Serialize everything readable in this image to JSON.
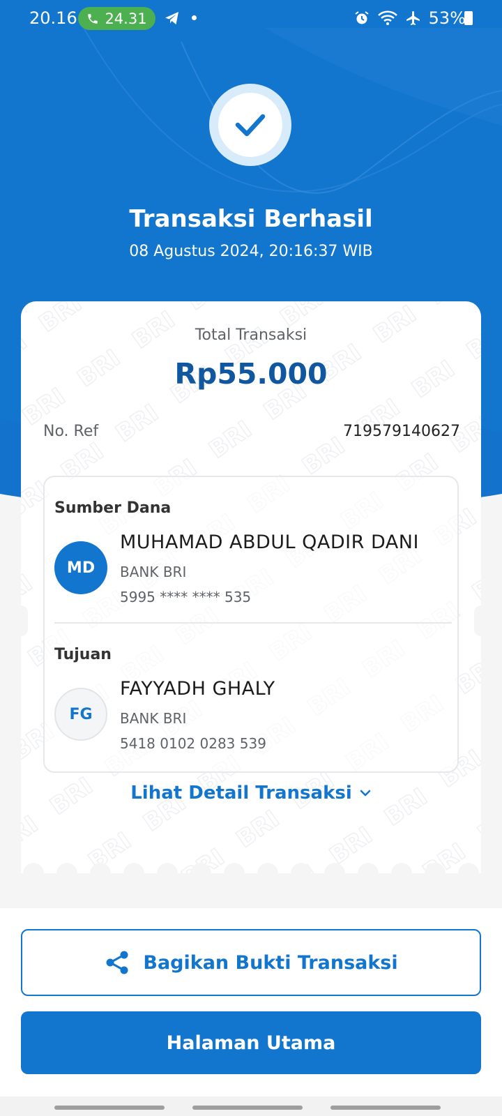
{
  "status_bar": {
    "time": "20.16",
    "call_duration": "24.31",
    "battery": "53%",
    "icons": [
      "phone-icon",
      "telegram-icon",
      "alarm-icon",
      "wifi-icon",
      "airplane-icon",
      "battery-icon"
    ]
  },
  "header": {
    "title": "Transaksi Berhasil",
    "datetime": "08 Agustus 2024, 20:16:37 WIB",
    "icon": "check-icon"
  },
  "card": {
    "watermark_text": "BRI",
    "total_label": "Total Transaksi",
    "total_amount": "Rp55.000",
    "ref_label": "No. Ref",
    "ref_value": "719579140627",
    "source": {
      "section_title": "Sumber Dana",
      "initials": "MD",
      "name": "MUHAMAD ABDUL QADIR DANI",
      "bank": "BANK BRI",
      "account": "5995 **** **** 535"
    },
    "destination": {
      "section_title": "Tujuan",
      "initials": "FG",
      "name": "FAYYADH GHALY",
      "bank": "BANK BRI",
      "account": "5418 0102 0283 539"
    },
    "detail_link": "Lihat Detail Transaksi"
  },
  "actions": {
    "share_label": "Bagikan Bukti Transaksi",
    "home_label": "Halaman Utama"
  },
  "colors": {
    "primary": "#1276cf",
    "amount": "#10579f",
    "call_badge": "#4caf50"
  }
}
